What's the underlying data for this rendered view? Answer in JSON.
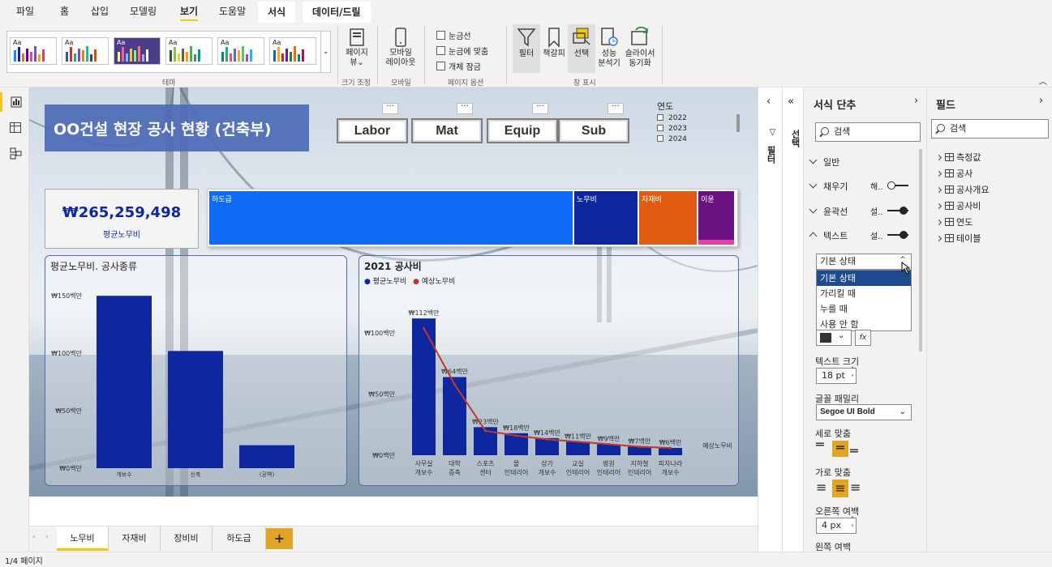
{
  "menu": {
    "items": [
      "파일",
      "홈",
      "삽입",
      "모델링",
      "보기",
      "도움말"
    ],
    "active": "보기",
    "context_tabs": [
      "서식",
      "데이터/드릴"
    ]
  },
  "ribbon": {
    "groups": {
      "theme": "테마",
      "size": "크기 조정",
      "mobile": "모바일",
      "page_options": "페이지 옵션",
      "show": "창 표시"
    },
    "buttons": {
      "page_view": [
        "페이지",
        "뷰"
      ],
      "mobile_layout": [
        "모바일",
        "레이아웃"
      ],
      "filter": "필터",
      "bookmark": "책갈피",
      "selection": "선택",
      "performance": [
        "성능",
        "분석기"
      ],
      "slicer_sync": [
        "슬라이서",
        "동기화"
      ]
    },
    "checkboxes": [
      "눈금선",
      "눈금에 맞춤",
      "개체 잠금"
    ],
    "theme_label": "Aa"
  },
  "report": {
    "title": "OO건설 현장 공사 현황 (건축부)",
    "nav_buttons": [
      "Labor",
      "Mat",
      "Equip",
      "Sub"
    ],
    "slicer": {
      "title": "연도",
      "items": [
        "2022",
        "2023",
        "2024"
      ]
    },
    "kpi": {
      "value": "₩265,259,498",
      "label": "평균노무비"
    },
    "treemap": [
      {
        "label": "하도급",
        "value": 0.59,
        "color": "#0f6cf5"
      },
      {
        "label": "노무비",
        "value": 0.105,
        "color": "#0e279e"
      },
      {
        "label": "자재비",
        "value": 0.095,
        "color": "#e05c12"
      },
      {
        "label": "이윤",
        "value": 0.06,
        "color": "#6b1080"
      }
    ]
  },
  "chart_data": [
    {
      "type": "bar",
      "title": "평균노무비. 공사종류",
      "categories": [
        "개보수",
        "신축",
        "(공백)"
      ],
      "values": [
        150,
        102,
        20
      ],
      "ylim": [
        0,
        160
      ],
      "yticks": [
        "₩0백만",
        "₩50백만",
        "₩100백만",
        "₩150백만"
      ],
      "color": "#0e279e"
    },
    {
      "type": "bar",
      "title": "2021 공사비",
      "legend": [
        "평균노무비",
        "예상노무비"
      ],
      "legend_colors": [
        "#0e279e",
        "#c0392b"
      ],
      "categories": [
        "사무실 개보수",
        "대학 증축",
        "스포츠 센터",
        "몰 인테리어",
        "상가 개보수",
        "교실 인테리어",
        "병원 인테리어",
        "지하철 인테리어",
        "피자나라 개보수"
      ],
      "series": [
        {
          "name": "평균노무비",
          "values": [
            112,
            64,
            23,
            18,
            14,
            11,
            9,
            7,
            6
          ],
          "labels": [
            "₩112백만",
            "₩64백만",
            "₩23백만",
            "₩18백만",
            "₩14백만",
            "₩11백만",
            "₩9백만",
            "₩7백만",
            "₩6백만"
          ]
        },
        {
          "name": "예상노무비",
          "values": [
            104,
            58,
            20,
            16,
            13,
            11,
            9,
            7,
            6
          ]
        }
      ],
      "ylim": [
        0,
        130
      ],
      "yticks": [
        "₩0백만",
        "₩50백만",
        "₩100백만"
      ],
      "xlabel": "예상노무비"
    }
  ],
  "page_tabs": [
    "노무비",
    "자재비",
    "장비비",
    "하도급"
  ],
  "active_page": "노무비",
  "add_tab": "+",
  "status": "1/4 페이지",
  "filter_pane": {
    "label_filter": "필터",
    "label_select": "선택"
  },
  "format_pane": {
    "title": "서식 단추",
    "search_placeholder": "검색",
    "sections": [
      {
        "label": "일반",
        "state": "collapsed"
      },
      {
        "label": "채우기",
        "state": "collapsed",
        "toggle": "해..",
        "on": false
      },
      {
        "label": "윤곽선",
        "state": "collapsed",
        "toggle": "설..",
        "on": true
      },
      {
        "label": "텍스트",
        "state": "expanded",
        "toggle": "설..",
        "on": true
      }
    ],
    "state_dropdown": {
      "value": "기본 상태",
      "options": [
        "기본 상태",
        "가리킬 때",
        "누를 때",
        "사용 안 함"
      ],
      "selected": "기본 상태"
    },
    "text_size_label": "텍스트 크기",
    "text_size": "18",
    "text_size_unit": "pt",
    "font_family_label": "글꼴 패밀리",
    "font_family": "Segoe UI Bold",
    "valign_label": "세로 맞춤",
    "halign_label": "가로 맞춤",
    "right_pad_label": "오른쪽 여백",
    "right_pad": "4",
    "right_pad_unit": "px",
    "left_pad_label": "왼쪽 여백",
    "fx": "fx"
  },
  "field_pane": {
    "title": "필드",
    "search_placeholder": "검색",
    "items": [
      "측정값",
      "공사",
      "공사개요",
      "공사비",
      "연도",
      "테이블"
    ]
  },
  "colors": {
    "accent": "#f2c811",
    "title_bg": "#4d6cb8",
    "bar": "#0e279e",
    "line": "#c0392b"
  }
}
